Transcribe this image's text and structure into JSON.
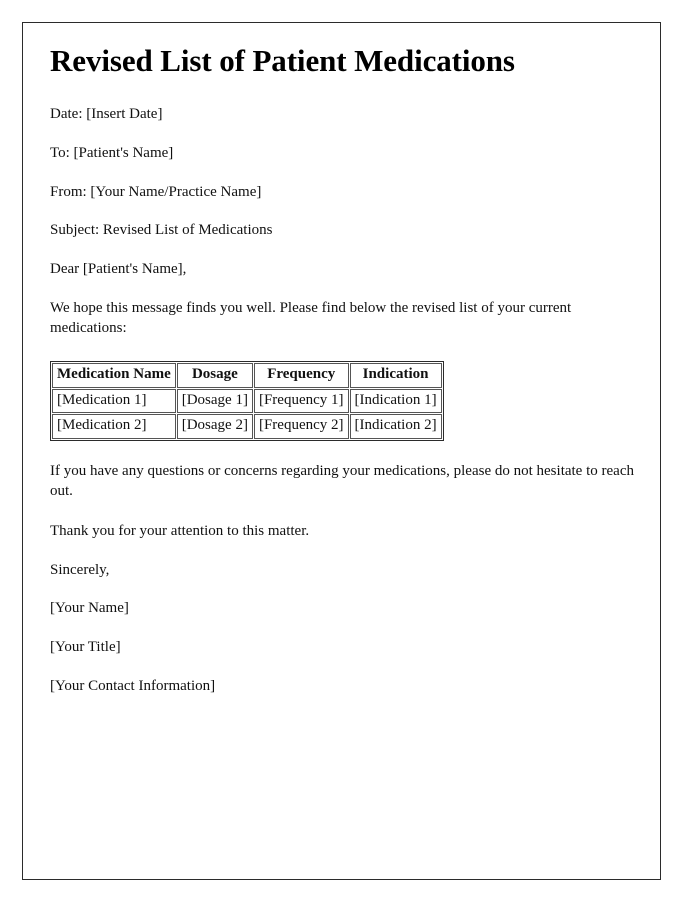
{
  "document": {
    "title": "Revised List of Patient Medications",
    "header_lines": [
      "Date: [Insert Date]",
      "To: [Patient's Name]",
      "From: [Your Name/Practice Name]",
      "Subject: Revised List of Medications",
      "Dear [Patient's Name],"
    ],
    "intro_paragraph": "We hope this message finds you well. Please find below the revised list of your current medications:",
    "table": {
      "columns": [
        "Medication Name",
        "Dosage",
        "Frequency",
        "Indication"
      ],
      "rows": [
        [
          "[Medication 1]",
          "[Dosage 1]",
          "[Frequency 1]",
          "[Indication 1]"
        ],
        [
          "[Medication 2]",
          "[Dosage 2]",
          "[Frequency 2]",
          "[Indication 2]"
        ]
      ]
    },
    "closing_paragraphs": [
      "If you have any questions or concerns regarding your medications, please do not hesitate to reach out.",
      "Thank you for your attention to this matter."
    ],
    "signature_lines": [
      "Sincerely,",
      "[Your Name]",
      "[Your Title]",
      "[Your Contact Information]"
    ]
  },
  "colors": {
    "page_background": "#ffffff",
    "text": "#111111",
    "frame_border": "#2b2b2b",
    "table_cell_border": "#555555"
  }
}
